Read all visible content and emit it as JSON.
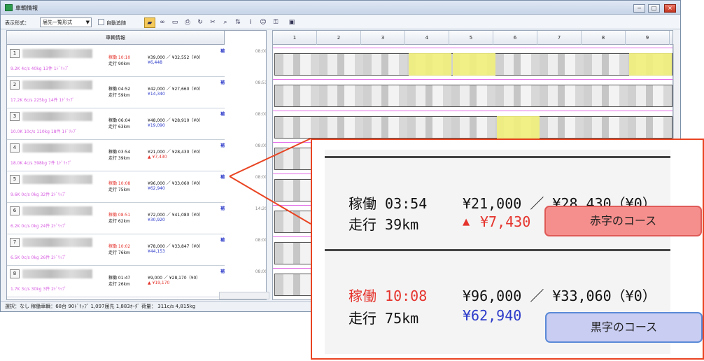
{
  "window": {
    "title": "車輌情報"
  },
  "toolbar": {
    "display_label": "表示形式：",
    "display_value": "届先一覧形式",
    "auto_label": "自動追随"
  },
  "left_panel": {
    "header": "車輌情報"
  },
  "vehicles": [
    {
      "no": "1",
      "stats": "9.2K 4c/s 40kg 13件 1ﾄﾞﾘｯﾌﾟ",
      "work": "稼働 10:10",
      "work_red": true,
      "run": "走行 90km",
      "amount": "¥39,000 ／ ¥32,552（¥0）",
      "diff": "¥6,448",
      "diff_red": false,
      "time": "08:00",
      "highlights": [
        2,
        3,
        7
      ]
    },
    {
      "no": "2",
      "stats": "17.2K 6c/s 225kg 14件 1ﾄﾞﾘｯﾌﾟ",
      "work": "稼働 04:52",
      "work_red": false,
      "run": "走行 59km",
      "amount": "¥42,000 ／ ¥27,660（¥0）",
      "diff": "¥14,340",
      "diff_red": false,
      "time": "08:51",
      "highlights": []
    },
    {
      "no": "3",
      "stats": "10.0K 10c/s 110kg 18件 1ﾄﾞﾘｯﾌﾟ",
      "work": "稼働 06:04",
      "work_red": false,
      "run": "走行 63km",
      "amount": "¥48,000 ／ ¥28,910（¥0）",
      "diff": "¥19,090",
      "diff_red": false,
      "time": "08:00",
      "highlights": [
        4
      ]
    },
    {
      "no": "4",
      "stats": "18.0K 4c/s 398kg 7件 1ﾄﾞﾘｯﾌﾟ",
      "work": "稼働 03:54",
      "work_red": false,
      "run": "走行 39km",
      "amount": "¥21,000 ／ ¥28,430（¥0）",
      "diff": "▲ ¥7,430",
      "diff_red": true,
      "time": "08:00",
      "highlights": []
    },
    {
      "no": "5",
      "stats": "9.6K 0c/s 0kg 32件 2ﾄﾞﾘｯﾌﾟ",
      "work": "稼働 10:08",
      "work_red": true,
      "run": "走行 75km",
      "amount": "¥96,000 ／ ¥33,060（¥0）",
      "diff": "¥62,940",
      "diff_red": false,
      "time": "08:00",
      "highlights": []
    },
    {
      "no": "6",
      "stats": "6.2K 0c/s 0kg 24件 2ﾄﾞﾘｯﾌﾟ",
      "work": "稼働 08:51",
      "work_red": true,
      "run": "走行 62km",
      "amount": "¥72,000 ／ ¥41,080（¥0）",
      "diff": "¥30,920",
      "diff_red": false,
      "time": "14:20",
      "highlights": [
        0
      ]
    },
    {
      "no": "7",
      "stats": "6.5K 0c/s 0kg 26件 2ﾄﾞﾘｯﾌﾟ",
      "work": "稼働 10:02",
      "work_red": true,
      "run": "走行 76km",
      "amount": "¥78,000 ／ ¥33,847（¥0）",
      "diff": "¥44,153",
      "diff_red": false,
      "time": "08:00",
      "highlights": [
        0
      ]
    },
    {
      "no": "8",
      "stats": "1.7K 3c/s 30kg 3件 2ﾄﾞﾘｯﾌﾟ",
      "work": "稼働 01:47",
      "work_red": false,
      "run": "走行 26km",
      "amount": "¥9,000 ／ ¥28,170（¥0）",
      "diff": "▲ ¥19,170",
      "diff_red": true,
      "time": "08:00",
      "highlights": []
    }
  ],
  "columns": [
    "1",
    "2",
    "3",
    "4",
    "5",
    "6",
    "7",
    "8",
    "9"
  ],
  "status_bar": "選択：なし  稼働車輌：68台 90ﾄﾞﾘｯﾌﾟ 1,097届先 1,883ｵｰﾀﾞ  荷量：  311c/s  4,815kg",
  "zoom": {
    "red_course": {
      "work": "稼働 03:54",
      "amount": "¥21,000 ／ ¥28,430（¥0）",
      "run": "走行 39km",
      "triangle": "▲",
      "diff": "¥7,430"
    },
    "black_course": {
      "work": "稼働 10:08",
      "amount": "¥96,000 ／ ¥33,060（¥0）",
      "run": "走行 75km",
      "diff": "¥62,940"
    }
  },
  "labels": {
    "red": "赤字のコース",
    "black": "黒字のコース"
  }
}
